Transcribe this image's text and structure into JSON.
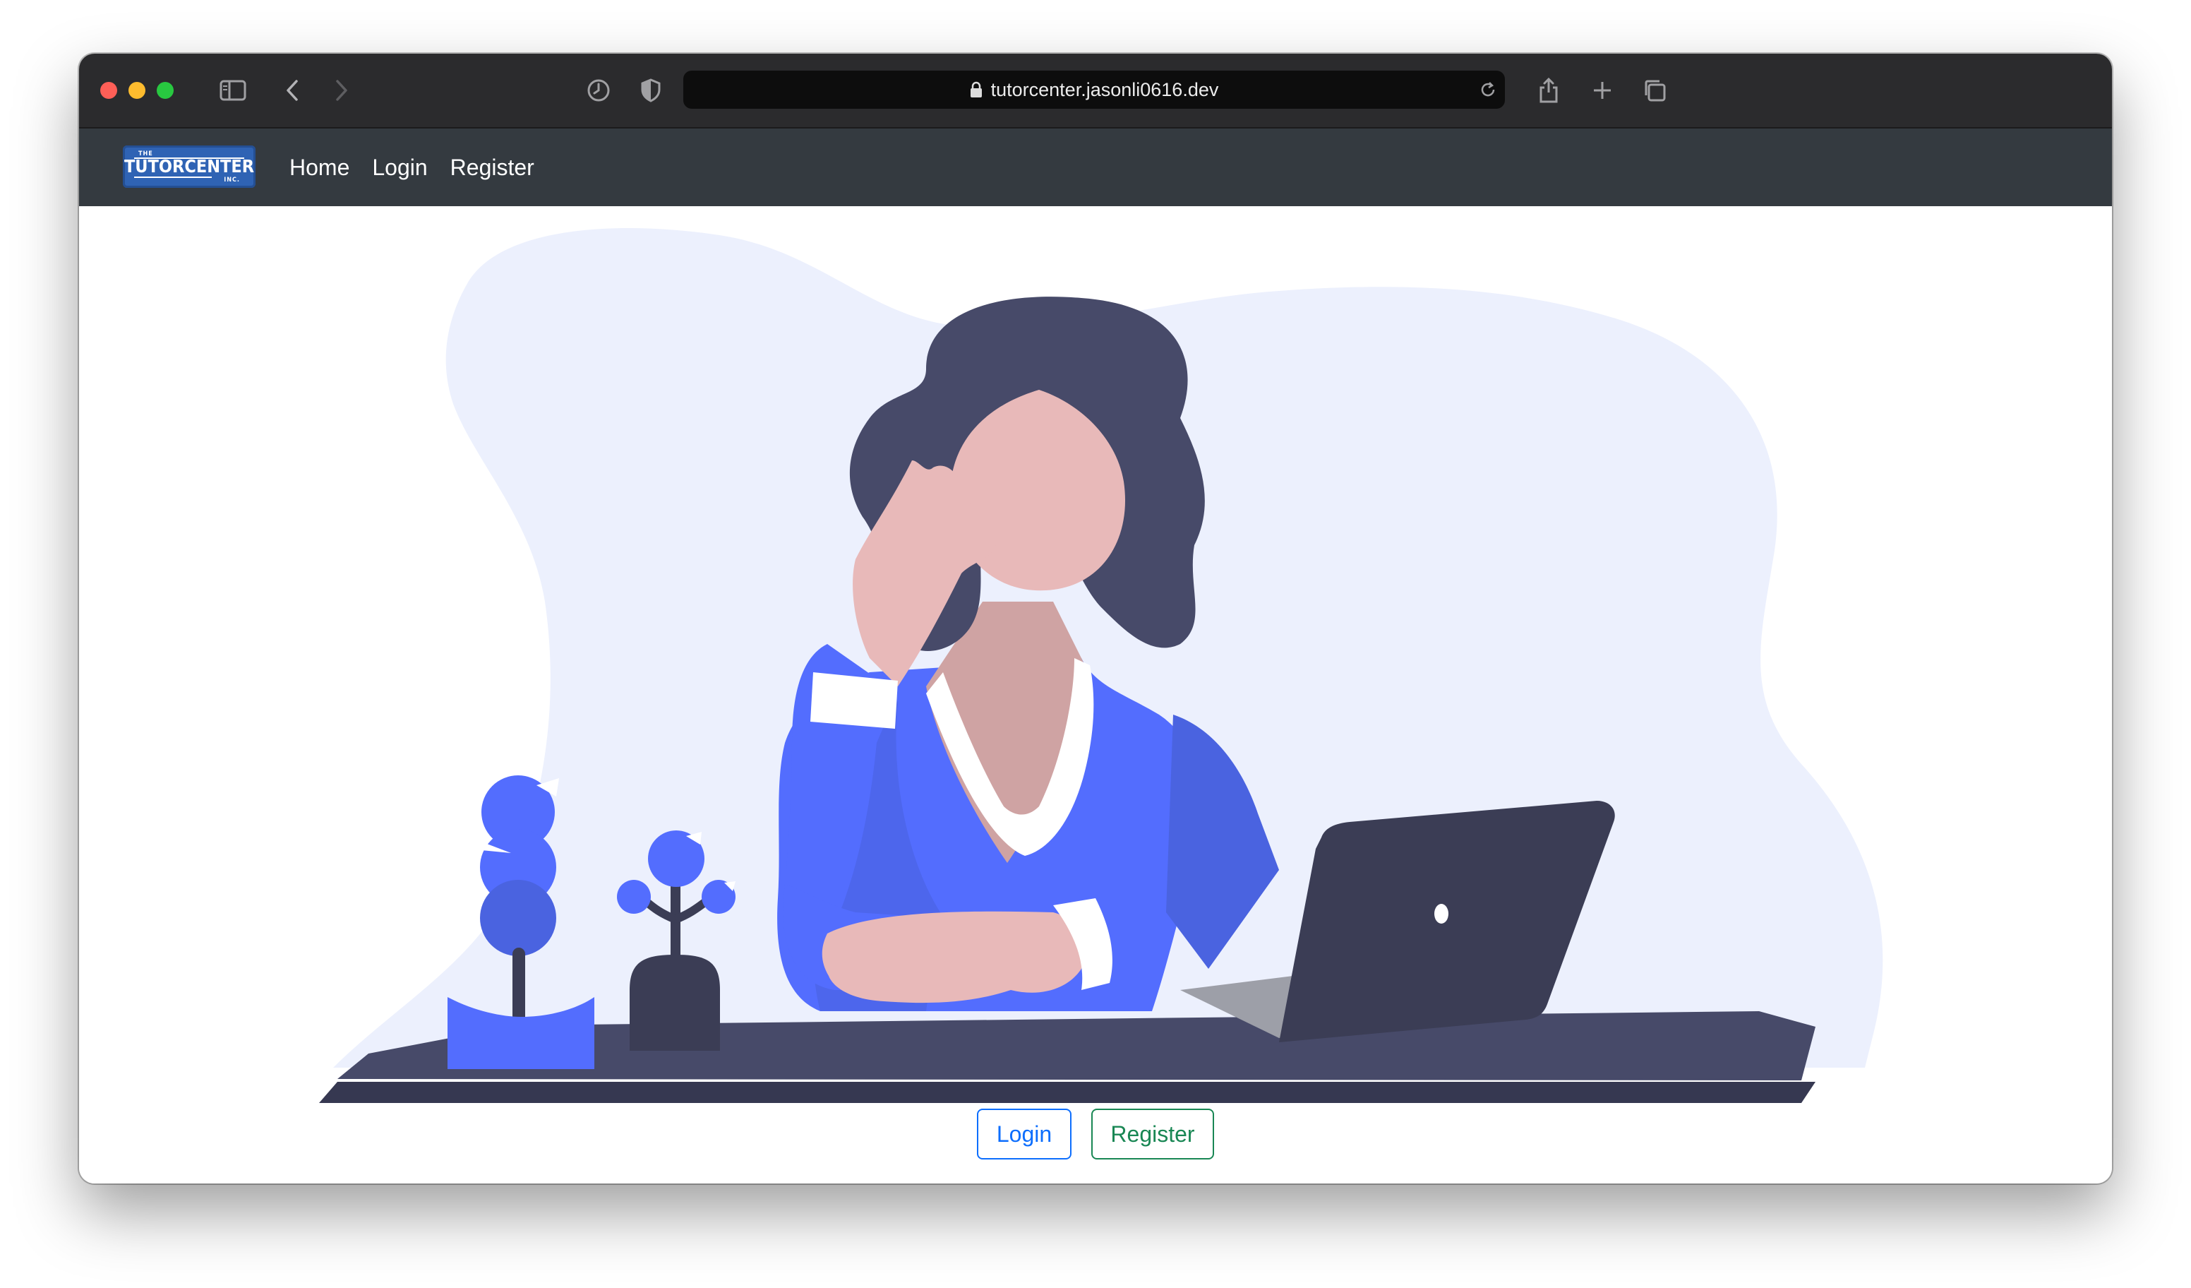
{
  "browser": {
    "url": "tutorcenter.jasonli0616.dev",
    "traffic_colors": {
      "close": "#ff5f57",
      "minimize": "#febc2e",
      "zoom": "#28c840"
    }
  },
  "navbar": {
    "logo": {
      "top": "THE",
      "main": "TUTORCENTER",
      "bottom": "INC."
    },
    "links": [
      {
        "label": "Home"
      },
      {
        "label": "Login"
      },
      {
        "label": "Register"
      }
    ]
  },
  "actions": {
    "login_label": "Login",
    "register_label": "Register"
  },
  "colors": {
    "navbar_bg": "#343a40",
    "logo_bg": "#2f63b4",
    "accent_blue": "#536dfe",
    "login_outline": "#0d6efd",
    "register_outline": "#198754"
  }
}
